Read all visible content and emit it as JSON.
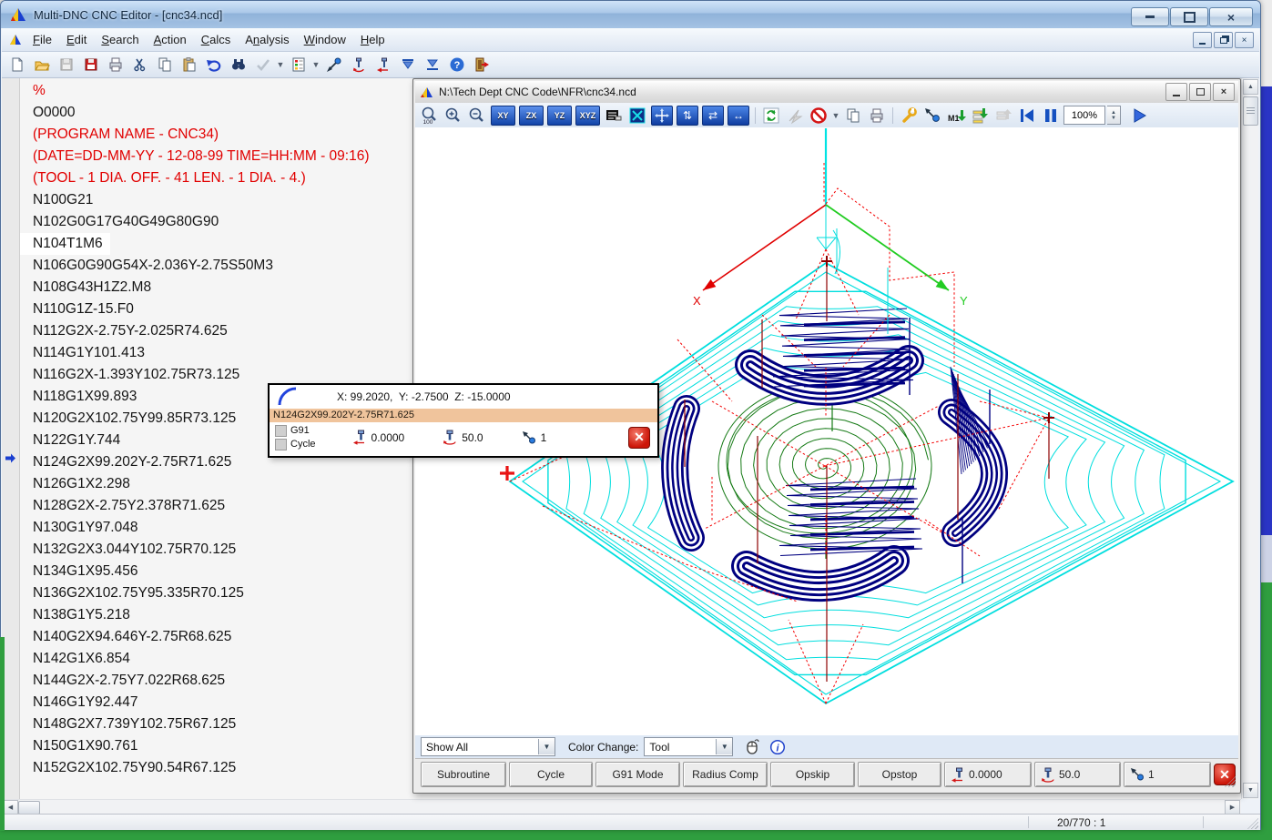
{
  "window": {
    "title": "Multi-DNC CNC Editor - [cnc34.ncd]"
  },
  "menu": {
    "items": [
      {
        "pre": "",
        "key": "F",
        "post": "ile"
      },
      {
        "pre": "",
        "key": "E",
        "post": "dit"
      },
      {
        "pre": "",
        "key": "S",
        "post": "earch"
      },
      {
        "pre": "",
        "key": "A",
        "post": "ction"
      },
      {
        "pre": "",
        "key": "C",
        "post": "alcs"
      },
      {
        "pre": "A",
        "key": "n",
        "post": "alysis"
      },
      {
        "pre": "",
        "key": "W",
        "post": "indow"
      },
      {
        "pre": "",
        "key": "H",
        "post": "elp"
      }
    ]
  },
  "editor": {
    "lines": [
      {
        "text": "%"
      },
      {
        "text": "O0000"
      },
      {
        "text": "(PROGRAM NAME - CNC34)"
      },
      {
        "text": "(DATE=DD-MM-YY - 12-08-99 TIME=HH:MM - 09:16)"
      },
      {
        "text": "(TOOL - 1 DIA. OFF. - 41 LEN. - 1 DIA. - 4.)"
      },
      {
        "text": "N100G21"
      },
      {
        "text": "N102G0G17G40G49G80G90"
      },
      {
        "text": "N104T1M6"
      },
      {
        "text": "N106G0G90G54X-2.036Y-2.75S50M3"
      },
      {
        "text": "N108G43H1Z2.M8"
      },
      {
        "text": "N110G1Z-15.F0"
      },
      {
        "text": "N112G2X-2.75Y-2.025R74.625"
      },
      {
        "text": "N114G1Y101.413"
      },
      {
        "text": "N116G2X-1.393Y102.75R73.125"
      },
      {
        "text": "N118G1X99.893"
      },
      {
        "text": "N120G2X102.75Y99.85R73.125"
      },
      {
        "text": "N122G1Y.744"
      },
      {
        "text": "N124G2X99.202Y-2.75R71.625"
      },
      {
        "text": "N126G1X2.298"
      },
      {
        "text": "N128G2X-2.75Y2.378R71.625"
      },
      {
        "text": "N130G1Y97.048"
      },
      {
        "text": "N132G2X3.044Y102.75R70.125"
      },
      {
        "text": "N134G1X95.456"
      },
      {
        "text": "N136G2X102.75Y95.335R70.125"
      },
      {
        "text": "N138G1Y5.218"
      },
      {
        "text": "N140G2X94.646Y-2.75R68.625"
      },
      {
        "text": "N142G1X6.854"
      },
      {
        "text": "N144G2X-2.75Y7.022R68.625"
      },
      {
        "text": "N146G1Y92.447"
      },
      {
        "text": "N148G2X7.739Y102.75R67.125"
      },
      {
        "text": "N150G1X90.761"
      },
      {
        "text": "N152G2X102.75Y90.54R67.125"
      }
    ]
  },
  "child_window": {
    "title": "N:\\Tech Dept CNC Code\\NFR\\cnc34.ncd",
    "toolbar": {
      "zoom_100_label": "100",
      "view_buttons": [
        "XY",
        "ZX",
        "YZ",
        "XYZ"
      ],
      "m1_label": "M1",
      "zoom_level": "100%"
    },
    "filter_bar": {
      "show_filter": "Show All",
      "color_change_label": "Color Change:",
      "color_mode": "Tool"
    },
    "status_buttons": [
      "Subroutine",
      "Cycle",
      "G91 Mode",
      "Radius Comp",
      "Opskip",
      "Opstop"
    ],
    "status_fields": {
      "depth": "0.0000",
      "feed": "50.0",
      "tool": "1"
    }
  },
  "tooltip": {
    "coords": "X: 99.2020,  Y: -2.7500  Z: -15.0000",
    "line_text": "N124G2X99.202Y-2.75R71.625",
    "g91_label": "G91",
    "cycle_label": "Cycle",
    "depth": "0.0000",
    "feed": "50.0",
    "tool": "1"
  },
  "axes": {
    "x_label": "X",
    "y_label": "Y"
  },
  "status_bar": {
    "position": "20/770 : 1"
  },
  "colors": {
    "accent_blue": "#1244a8",
    "toolpath_cyan": "#00dede",
    "toolpath_green": "#157a15",
    "toolpath_navy": "#000080",
    "rapid_red": "#f40000",
    "comment_red": "#e10000"
  }
}
